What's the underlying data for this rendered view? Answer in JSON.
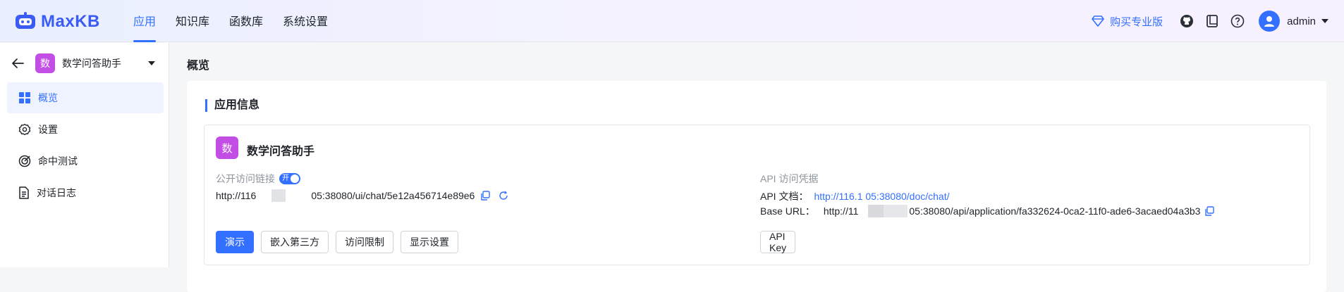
{
  "brand": {
    "name": "MaxKB",
    "color": "#3b5bf5"
  },
  "nav": {
    "items": [
      {
        "label": "应用",
        "active": true
      },
      {
        "label": "知识库",
        "active": false
      },
      {
        "label": "函数库",
        "active": false
      },
      {
        "label": "系统设置",
        "active": false
      }
    ]
  },
  "topbar": {
    "buy_label": "购买专业版",
    "icons": [
      "github-icon",
      "book-icon",
      "help-icon"
    ],
    "user": "admin"
  },
  "sidebar": {
    "app_badge": "数",
    "app_name": "数学问答助手",
    "menu": [
      {
        "label": "概览",
        "icon": "overview-grid-icon",
        "active": true
      },
      {
        "label": "设置",
        "icon": "gear-icon",
        "active": false
      },
      {
        "label": "命中测试",
        "icon": "target-icon",
        "active": false
      },
      {
        "label": "对话日志",
        "icon": "document-icon",
        "active": false
      }
    ]
  },
  "main": {
    "breadcrumb": "概览",
    "section_title": "应用信息",
    "app": {
      "badge": "数",
      "name": "数学问答助手",
      "public_label": "公开访问链接",
      "toggle_label": "开",
      "url_prefix": "http://116",
      "url_suffix": "05:38080/ui/chat/5e12a456714e89e6"
    },
    "buttons": [
      {
        "label": "演示",
        "primary": true
      },
      {
        "label": "嵌入第三方",
        "primary": false
      },
      {
        "label": "访问限制",
        "primary": false
      },
      {
        "label": "显示设置",
        "primary": false
      }
    ],
    "api": {
      "label": "API 访问凭据",
      "doc_label": "API 文档：",
      "doc_url": "http://116.1    05:38080/doc/chat/",
      "base_label": "Base URL：",
      "base_prefix": "http://11",
      "base_suffix": "05:38080/api/application/fa332624-0ca2-11f0-ade6-3acaed04a3b3",
      "key_button": "API Key"
    }
  },
  "colors": {
    "accent": "#3370ff",
    "badge": "#c34ee5"
  }
}
